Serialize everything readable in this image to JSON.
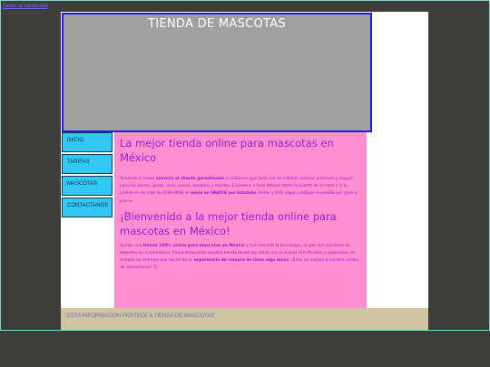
{
  "skip_link": "Saltar al contenido",
  "banner": {
    "title": "TIENDA DE MASCOTAS"
  },
  "nav": {
    "items": [
      {
        "label": "INICIO"
      },
      {
        "label": "TARIFAS"
      },
      {
        "label": "MASCOTAS"
      },
      {
        "label": "CONTACTANOS"
      }
    ]
  },
  "content": {
    "heading1": "La mejor tienda online para mascotas en México",
    "para1": {
      "t1": "Tenemos el mejor ",
      "b1": "servicio al cliente garantizado",
      "t2": " y cuidamos que todo sea de calidad, natural, premium y seguro para tus perros, gatos, aves, peces, roedores y reptiles. Enviamos a todo México hasta la puerta de tu casa y si tu pedido es de más de $599 MXN, el ",
      "b2": "envío es GRATIS por Estafeta",
      "t3": ", Fedex y DHL según califique tu pedido por peso y precio."
    },
    "heading2": "¡Bienvenido a la mejor tienda online para mascotas en México!",
    "para2": {
      "t1": "Somos una ",
      "b1": "tienda 100% online para mascotas en México",
      "t2": " y nos encanta la tecnología, lo que nos convierte en expertos en e-commerce. Preparamos todo nuestra tienda desde las raíces con procesos tecnificados y estaciones de armado de órdenes que hacen de tu ",
      "b2": "experiencia de compra en línea algo único",
      "t3": ". ¡Echa un vistazo a nuestro centro de operaciones! ☺"
    }
  },
  "footer": {
    "text": "ESTA INFORMACION PERTECE A TIENDA DE MASCOTAS"
  },
  "colors": {
    "background": "#3f3d39",
    "banner": "#a0a0a0",
    "banner_border": "#1a1aff",
    "nav": "#33c7f4",
    "content": "#ff8fd0",
    "text": "#9a1bd1",
    "footer": "#cfc4a0"
  }
}
